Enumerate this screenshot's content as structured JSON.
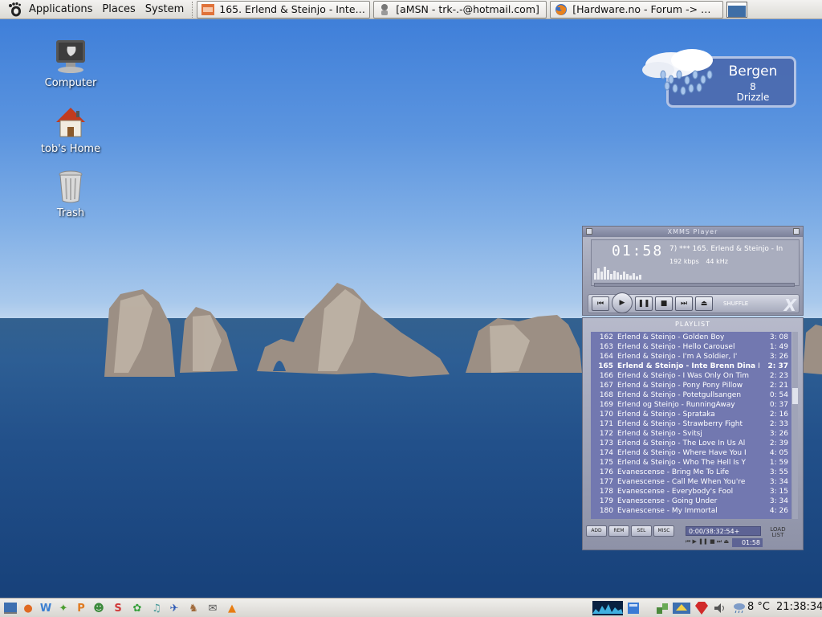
{
  "top_panel": {
    "menus": [
      "Applications",
      "Places",
      "System"
    ],
    "tasks": [
      {
        "label": "165. Erlend & Steinjo - Inte…",
        "icon": "xmms-icon"
      },
      {
        "label": "[aMSN - trk-.-@hotmail.com]",
        "icon": "amsn-icon"
      },
      {
        "label": "[Hardware.no - Forum -> …",
        "icon": "firefox-icon"
      }
    ]
  },
  "desktop": {
    "icons": [
      {
        "label": "Computer",
        "icon": "computer-icon"
      },
      {
        "label": "tob's Home",
        "icon": "home-folder-icon"
      },
      {
        "label": "Trash",
        "icon": "trash-icon"
      }
    ]
  },
  "weather": {
    "city": "Bergen",
    "temperature": "8",
    "condition": "Drizzle",
    "icon": "drizzle-cloud-icon"
  },
  "xmms": {
    "title": "XMMS Player",
    "time": "01:58",
    "song_info": "7) *** 165. Erlend & Steinjo - In",
    "bitrate": "192",
    "bitrate_unit": "kbps",
    "frequency": "44",
    "frequency_unit": "kHz",
    "shuffle_label": "SHUFFLE",
    "buttons": [
      "previous",
      "play",
      "pause",
      "stop",
      "next",
      "eject"
    ]
  },
  "playlist": {
    "title": "PLAYLIST",
    "current_index": 3,
    "rows": [
      {
        "num": "162",
        "track": "Erlend & Steinjo - Golden Boy",
        "time": "3: 08"
      },
      {
        "num": "163",
        "track": "Erlend & Steinjo - Hello Carousel",
        "time": "1: 49"
      },
      {
        "num": "164",
        "track": "Erlend & Steinjo - I'm A Soldier, I'",
        "time": "3: 26"
      },
      {
        "num": "165",
        "track": "Erlend & Steinjo - Inte Brenn Dina H",
        "time": "2: 37"
      },
      {
        "num": "166",
        "track": "Erlend & Steinjo - I Was Only On Tim",
        "time": "2: 23"
      },
      {
        "num": "167",
        "track": "Erlend & Steinjo - Pony Pony Pillow",
        "time": "2: 21"
      },
      {
        "num": "168",
        "track": "Erlend & Steinjo - Potetgullsangen",
        "time": "0: 54"
      },
      {
        "num": "169",
        "track": "Erlend og Steinjo - RunningAway",
        "time": "0: 37"
      },
      {
        "num": "170",
        "track": "Erlend & Steinjo - Sprataka",
        "time": "2: 16"
      },
      {
        "num": "171",
        "track": "Erlend & Steinjo - Strawberry Fight",
        "time": "2: 33"
      },
      {
        "num": "172",
        "track": "Erlend & Steinjo - Svitsj",
        "time": "3: 26"
      },
      {
        "num": "173",
        "track": "Erlend & Steinjo - The Love In Us Al",
        "time": "2: 39"
      },
      {
        "num": "174",
        "track": "Erlend & Steinjo - Where Have You I",
        "time": "4: 05"
      },
      {
        "num": "175",
        "track": "Erlend & Steinjo - Who The Hell Is Y",
        "time": "1: 59"
      },
      {
        "num": "176",
        "track": "Evanescense - Bring Me To Life",
        "time": "3: 55"
      },
      {
        "num": "177",
        "track": "Evanescense - Call Me When You're",
        "time": "3: 34"
      },
      {
        "num": "178",
        "track": "Evanescense - Everybody's Fool",
        "time": "3: 15"
      },
      {
        "num": "179",
        "track": "Evanescense - Going Under",
        "time": "3: 34"
      },
      {
        "num": "180",
        "track": "Evanescense - My Immortal",
        "time": "4: 26"
      }
    ],
    "buttons": [
      "ADD",
      "REM",
      "SEL",
      "MISC"
    ],
    "total_time": "0:00/38:32:54+",
    "mini_time": "01:58",
    "load_list": "LOAD LIST"
  },
  "bottom_panel": {
    "temperature": "8 °C",
    "clock": "21:38:34"
  }
}
